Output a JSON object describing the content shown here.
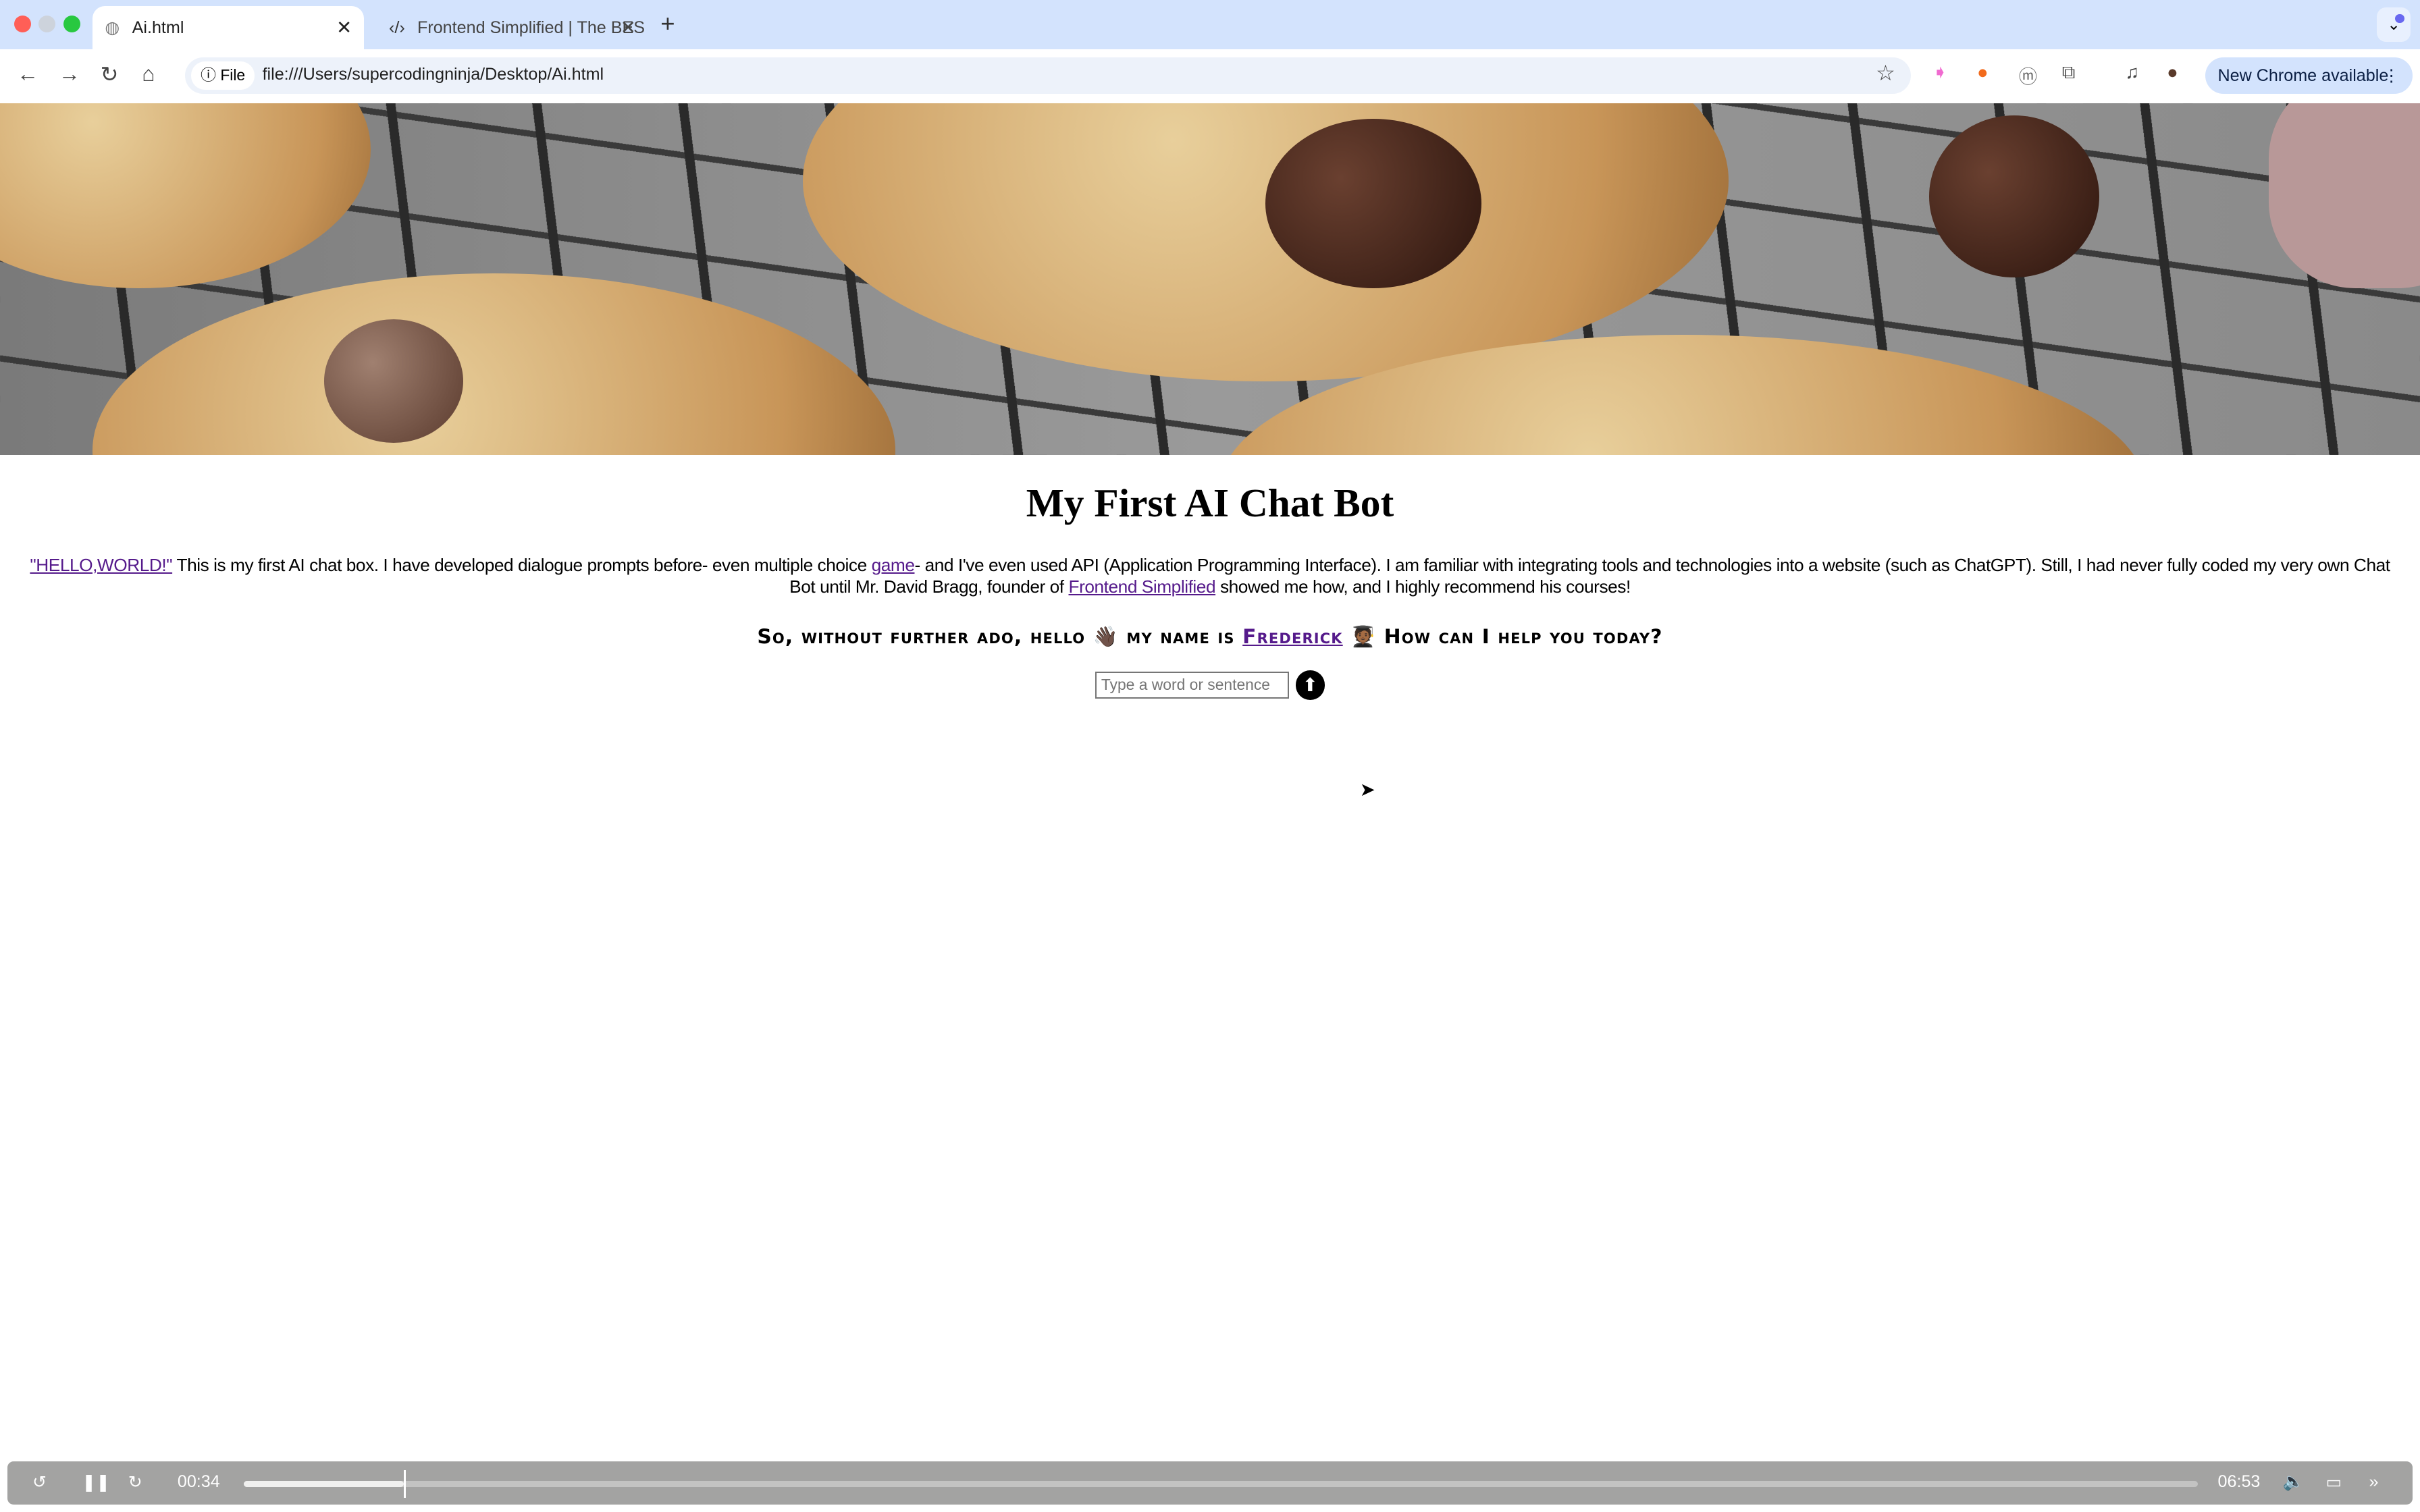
{
  "browser": {
    "tabs": [
      {
        "title": "Ai.html",
        "active": true,
        "icon": "globe-icon"
      },
      {
        "title": "Frontend Simplified | The BES",
        "active": false,
        "icon": "code-icon"
      }
    ],
    "chip_label": "File",
    "url": "file:///Users/supercodingninja/Desktop/Ai.html",
    "update_label": "New Chrome available"
  },
  "page": {
    "title": "My First AI Chat Bot",
    "intro": {
      "hello_link": "\"HELLO,WORLD!\"",
      "part1": " This is my first AI chat box. I have developed dialogue prompts before- even multiple choice ",
      "game_link": "game",
      "part2": "- and I've even used API (Application Programming Interface). I am familiar with integrating tools and technologies into a website (such as ChatGPT). Still, I had never fully coded my very own Chat Bot until Mr. David Bragg, founder of ",
      "fs_link": "Frontend Simplified",
      "part3": " showed me how, and I highly recommend his courses!"
    },
    "greeting": {
      "part1": "So, without further ado, hello ",
      "wave": "👋🏿",
      "part2": " my name is ",
      "name_link": "Frederick",
      "grad": "🧑🏾‍🎓",
      "part3": " How can I help you today?"
    },
    "input_placeholder": "Type a word or sentence",
    "send_icon": "arrow-up-icon",
    "link_color": "#551a8b"
  },
  "player": {
    "current": "00:34",
    "duration": "06:53",
    "progress_percent": 8.2
  }
}
